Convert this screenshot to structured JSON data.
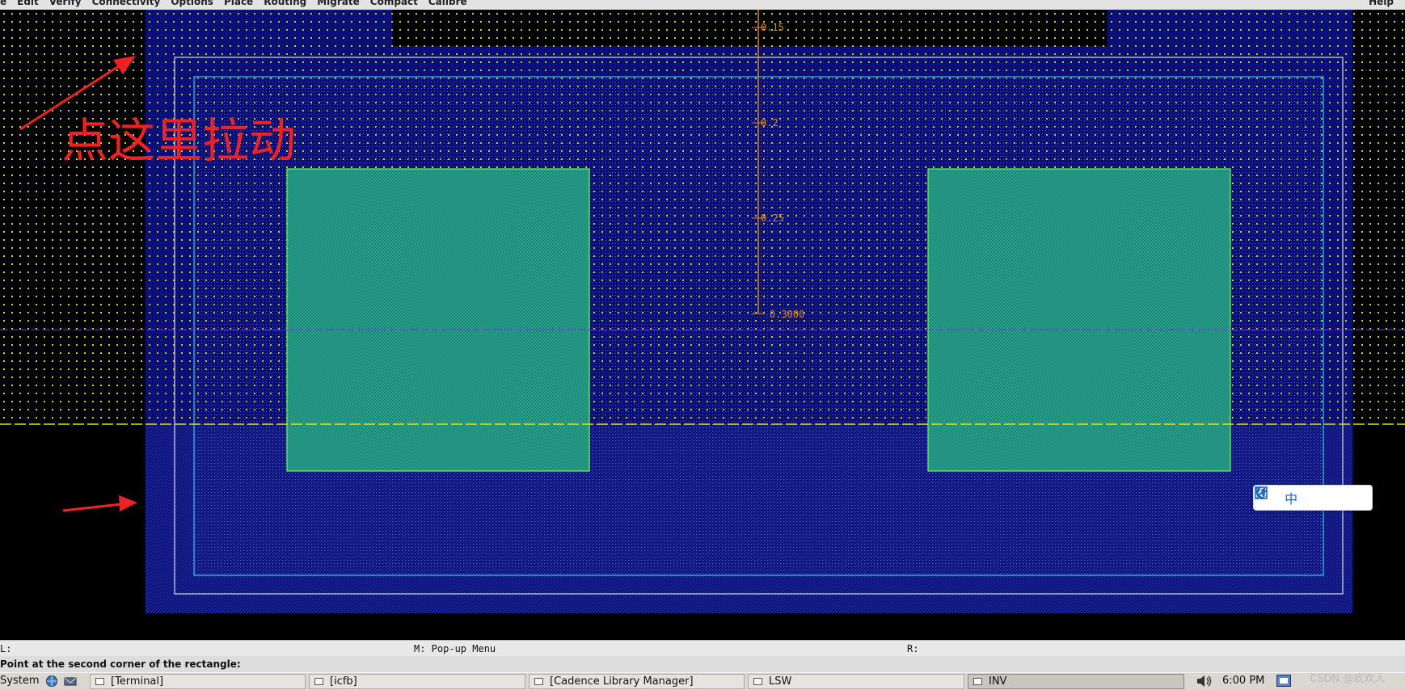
{
  "menubar": {
    "items": [
      "e",
      "Edit",
      "Verify",
      "Connectivity",
      "Options",
      "Place",
      "Routing",
      "Migrate",
      "Compact",
      "Calibre"
    ],
    "help": "Help"
  },
  "canvas": {
    "ruler_labels": [
      "0.15",
      "0.2",
      "0.25",
      "0.3000"
    ],
    "annotation_text": "点这里拉动",
    "colors": {
      "background": "#000000",
      "nwell": "#0a1077",
      "grid_dot": "#d6d600",
      "active_fill": "#1e9a7a",
      "active_edge": "#6aff4c",
      "cut_edge": "#35c8e6",
      "ruler": "#e08a1e",
      "annotation": "#ee2222",
      "axis_purple": "#7a30ff",
      "axis_yellow": "#e6e600"
    }
  },
  "ime_toolbar": {
    "icons": [
      "fullscreen-icon",
      "chinese-mode-icon",
      "moon-icon",
      "punctuation-icon",
      "wrench-icon"
    ],
    "chinese_label": "中"
  },
  "status": {
    "left": "L:",
    "middle": "M: Pop-up Menu",
    "right": "R:"
  },
  "prompt": {
    "text": "Point at the second corner of the rectangle:"
  },
  "taskbar": {
    "system_label": "System",
    "items": [
      "[Terminal]",
      "[icfb]",
      "[Cadence Library Manager]",
      "LSW",
      "INV"
    ],
    "active_item": "INV",
    "clock": "6:00 PM"
  },
  "watermark": "CSDN @欢欢人"
}
